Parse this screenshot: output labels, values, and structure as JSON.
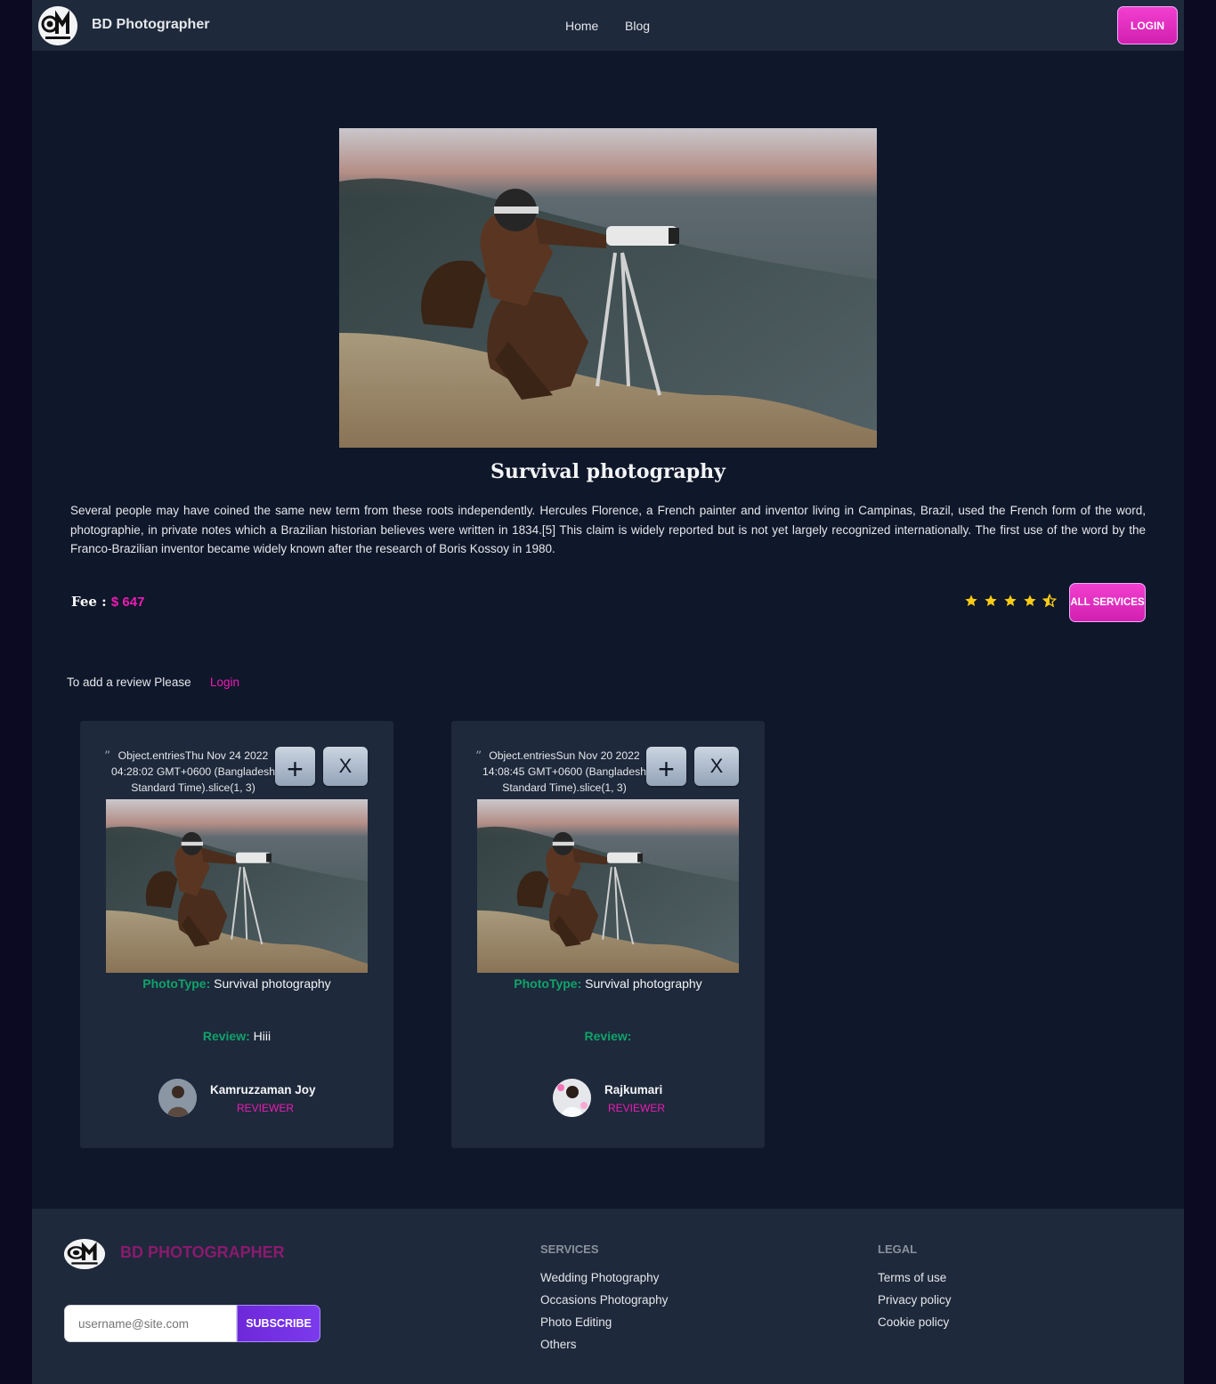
{
  "nav": {
    "brand": "BD Photographer",
    "links": [
      "Home",
      "Blog"
    ],
    "login_label": "LOGIN"
  },
  "service": {
    "title": "Survival photography",
    "description": "Several people may have coined the same new term from these roots independently. Hercules Florence, a French painter and inventor living in Campinas, Brazil, used the French form of the word, photographie, in private notes which a Brazilian historian believes were written in 1834.[5] This claim is widely reported but is not yet largely recognized internationally. The first use of the word by the Franco-Brazilian inventor became widely known after the research of Boris Kossoy in 1980.",
    "fee_label": "Fee :",
    "fee_value": "$ 647",
    "rating": 4.5,
    "all_services_label": "ALL SERVICES"
  },
  "review_prompt": {
    "text": "To add a review Please",
    "login_link": "Login"
  },
  "reviews": [
    {
      "date_text": "Object.entriesThu Nov 24 2022 04:28:02 GMT+0600 (Bangladesh Standard Time).slice(1, 3)",
      "add_label": "+",
      "delete_label": "X",
      "photo_type_label": "PhotoType:",
      "photo_type": "Survival photography",
      "review_label": "Review:",
      "review_text": "Hiii",
      "reviewer_name": "Kamruzzaman Joy",
      "reviewer_role": "REVIEWER"
    },
    {
      "date_text": "Object.entriesSun Nov 20 2022 14:08:45 GMT+0600 (Bangladesh Standard Time).slice(1, 3)",
      "add_label": "+",
      "delete_label": "X",
      "photo_type_label": "PhotoType:",
      "photo_type": "Survival photography",
      "review_label": "Review:",
      "review_text": "",
      "reviewer_name": "Rajkumari",
      "reviewer_role": "REVIEWER"
    }
  ],
  "footer": {
    "brand": "BD PHOTOGRAPHER",
    "email_placeholder": "username@site.com",
    "subscribe_label": "SUBSCRIBE",
    "services_heading": "SERVICES",
    "services": [
      "Wedding Photography",
      "Occasions Photography",
      "Photo Editing",
      "Others"
    ],
    "legal_heading": "LEGAL",
    "legal": [
      "Terms of use",
      "Privacy policy",
      "Cookie policy"
    ]
  },
  "colors": {
    "accent": "#ec1cb4",
    "green_label": "#10a36a",
    "page_bg": "#0f172a",
    "panel_bg": "#1e293b",
    "star": "#facc15"
  },
  "icons": [
    "logo-camera-icon",
    "star-icon",
    "star-half-icon",
    "quote-icon",
    "plus-icon",
    "close-icon"
  ]
}
